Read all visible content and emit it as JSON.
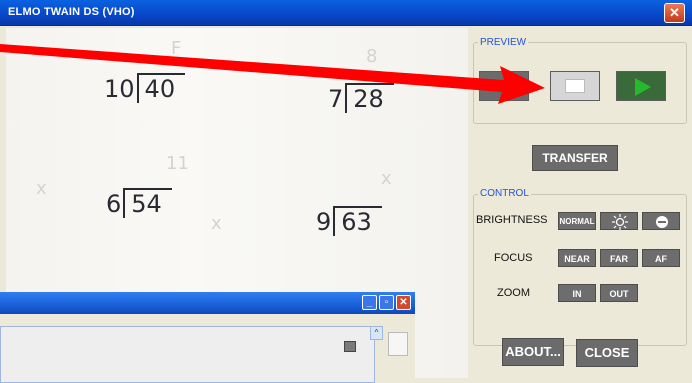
{
  "window": {
    "title": "ELMO TWAIN DS (VHO)",
    "close_glyph": "✕"
  },
  "preview_image": {
    "problems": [
      {
        "divisor": "10",
        "dividend": "40"
      },
      {
        "divisor": "7",
        "dividend": "28"
      },
      {
        "divisor": "6",
        "dividend": "54"
      },
      {
        "divisor": "9",
        "dividend": "63"
      }
    ]
  },
  "preview": {
    "label": "PREVIEW",
    "pause_icon": "pause-icon",
    "stop_icon": "stop-icon",
    "play_icon": "play-icon"
  },
  "transfer_label": "TRANSFER",
  "control": {
    "label": "CONTROL",
    "brightness_label": "BRIGHTNESS",
    "brightness_normal": "NORMAL",
    "focus_label": "FOCUS",
    "focus_near": "NEAR",
    "focus_far": "FAR",
    "focus_af": "AF",
    "zoom_label": "ZOOM",
    "zoom_in": "IN",
    "zoom_out": "OUT"
  },
  "about_label": "ABOUT...",
  "close_label": "CLOSE",
  "annotation": {
    "arrow_color": "#ff0000"
  },
  "colors": {
    "button_gray": "#6b6b6b",
    "group_label_blue": "#2355d6"
  }
}
